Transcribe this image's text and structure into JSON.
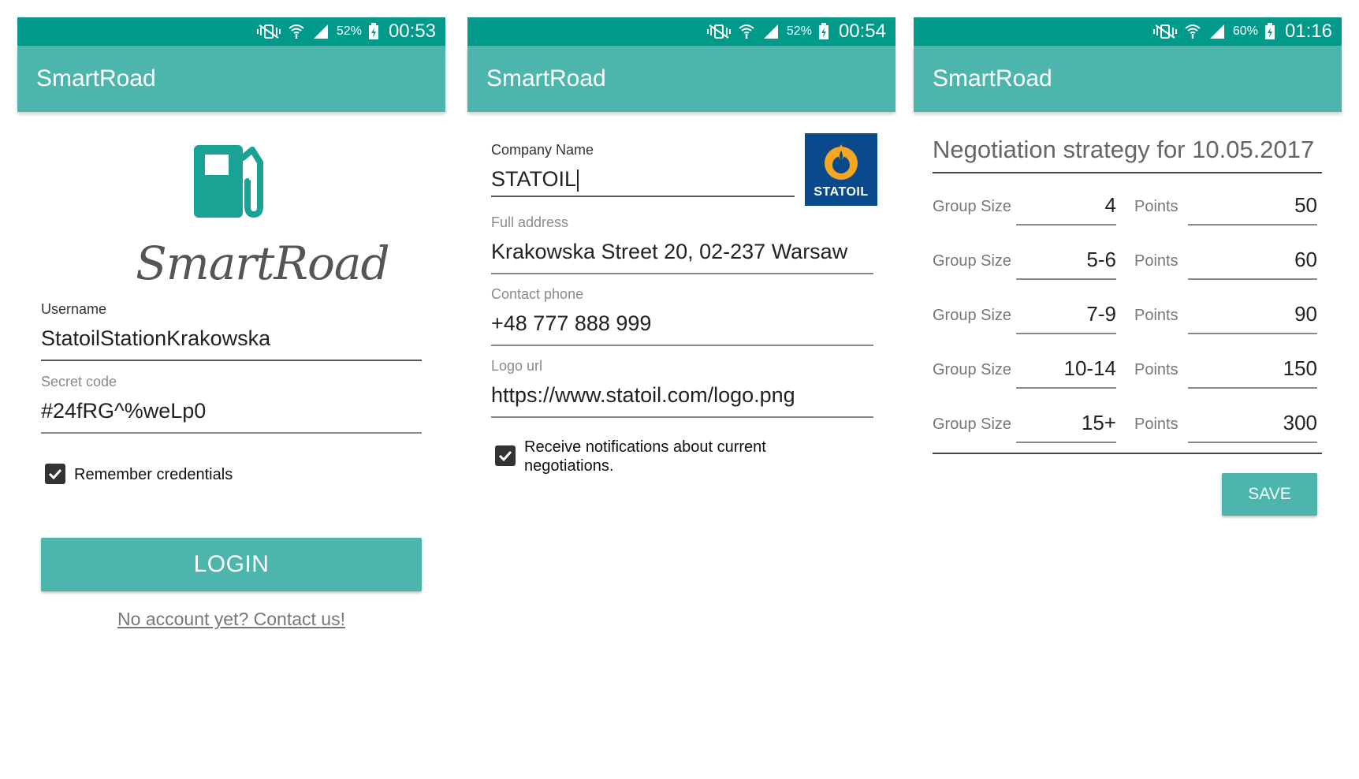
{
  "screens": [
    {
      "status": {
        "battery": "52%",
        "time": "00:53"
      },
      "app_title": "SmartRoad",
      "brand_script": "SmartRoad",
      "username": {
        "label": "Username",
        "value": "StatoilStationKrakowska"
      },
      "secret": {
        "label": "Secret code",
        "value": "#24fRG^%weLp0"
      },
      "remember": {
        "label": "Remember credentials",
        "checked": true
      },
      "login_label": "LOGIN",
      "contact_link": "No account yet? Contact us!"
    },
    {
      "status": {
        "battery": "52%",
        "time": "00:54"
      },
      "app_title": "SmartRoad",
      "company": {
        "label": "Company Name",
        "value": "STATOIL"
      },
      "company_logo_text": "STATOIL",
      "address": {
        "label": "Full address",
        "value": "Krakowska Street 20, 02-237 Warsaw"
      },
      "phone": {
        "label": "Contact phone",
        "value": "+48 777 888 999"
      },
      "logo_url": {
        "label": "Logo url",
        "value": "https://www.statoil.com/logo.png"
      },
      "notify": {
        "label_line1": "Receive notifications about current",
        "label_line2": "negotiations.",
        "checked": true
      }
    },
    {
      "status": {
        "battery": "60%",
        "time": "01:16"
      },
      "app_title": "SmartRoad",
      "title": "Negotiation strategy for 10.05.2017",
      "group_label": "Group Size",
      "points_label": "Points",
      "rows": [
        {
          "group": "4",
          "points": "50"
        },
        {
          "group": "5-6",
          "points": "60"
        },
        {
          "group": "7-9",
          "points": "90"
        },
        {
          "group": "10-14",
          "points": "150"
        },
        {
          "group": "15+",
          "points": "300"
        }
      ],
      "save_label": "SAVE"
    }
  ],
  "colors": {
    "status_bar": "#00998a",
    "app_bar": "#4db6ac",
    "statoil_blue": "#0a4a8c",
    "statoil_orange": "#f5a623"
  },
  "icons": [
    "vibrate-icon",
    "wifi-icon",
    "signal-icon",
    "battery-charging-icon",
    "fuel-pump-icon",
    "check-icon"
  ]
}
